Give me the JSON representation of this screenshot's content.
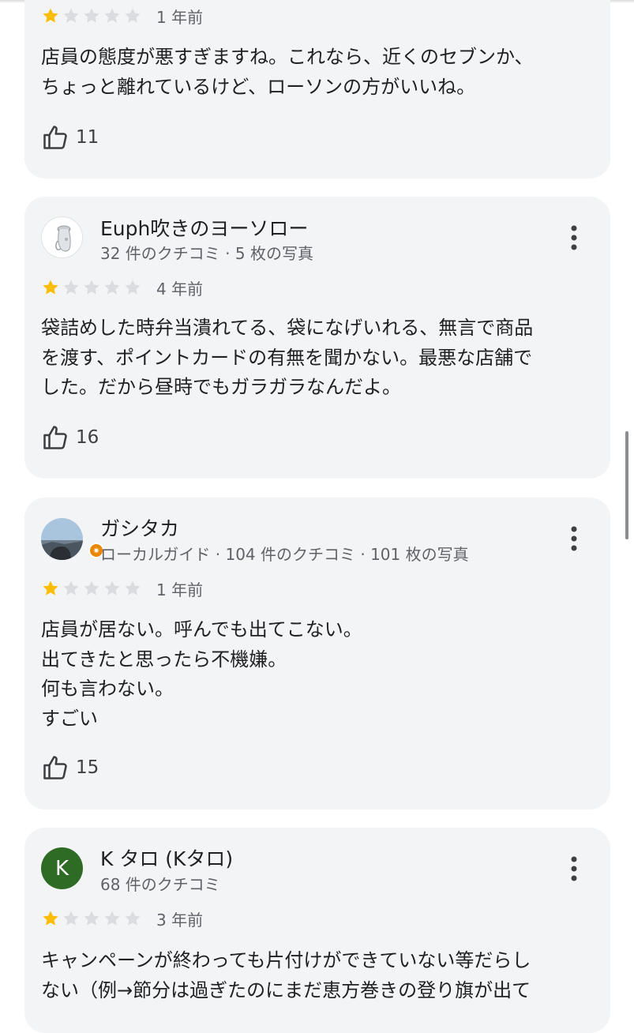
{
  "colors": {
    "accent_star": "#fbbc04",
    "empty_star": "#dadce0",
    "card_bg": "#f3f4f6",
    "avatar_k": "#2e6b24",
    "badge": "#ea8600"
  },
  "reviews": [
    {
      "name": "",
      "meta": "",
      "rating": 1,
      "when": "1 年前",
      "text": "店員の態度が悪すぎますね。これなら、近くのセブンか、\nちょっと離れているけど、ローソンの方がいいね。",
      "likes": "11"
    },
    {
      "name": "Euph吹きのヨーソロー",
      "meta": "32 件のクチコミ · 5 枚の写真",
      "rating": 1,
      "when": "4 年前",
      "text": "袋詰めした時弁当潰れてる、袋になげいれる、無言で商品\nを渡す、ポイントカードの有無を聞かない。最悪な店舗で\nした。だから昼時でもガラガラなんだよ。",
      "likes": "16",
      "avatar_icon": "euphonium-photo-icon"
    },
    {
      "name": "ガシタカ",
      "meta": "ローカルガイド · 104 件のクチコミ · 101 枚の写真",
      "rating": 1,
      "when": "1 年前",
      "text": "店員が居ない。呼んでも出てこない。\n出てきたと思ったら不機嫌。\n何も言わない。\nすごい",
      "likes": "15",
      "avatar_icon": "landscape-photo-icon",
      "badge_icon": "local-guide-star-icon"
    },
    {
      "name": "K タロ (Kタロ)",
      "meta": "68 件のクチコミ",
      "rating": 1,
      "when": "3 年前",
      "text": "キャンペーンが終わっても片付けができていない等だらし\nない（例→節分は過ぎたのにまだ恵方巻きの登り旗が出て",
      "likes": "",
      "avatar_letter": "K"
    }
  ]
}
